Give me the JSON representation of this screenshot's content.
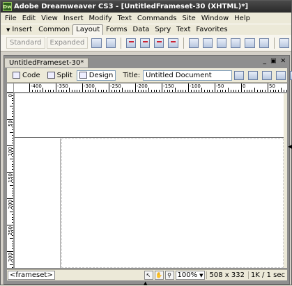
{
  "app": {
    "icon_text": "Dw",
    "title": "Adobe Dreamweaver CS3 - [UntitledFrameset-30 (XHTML)*]"
  },
  "menu": [
    "File",
    "Edit",
    "View",
    "Insert",
    "Modify",
    "Text",
    "Commands",
    "Site",
    "Window",
    "Help"
  ],
  "insert_bar": {
    "label": "Insert",
    "tabs": [
      {
        "label": "Common",
        "active": false
      },
      {
        "label": "Layout",
        "active": true
      },
      {
        "label": "Forms",
        "active": false
      },
      {
        "label": "Data",
        "active": false
      },
      {
        "label": "Spry",
        "active": false
      },
      {
        "label": "Text",
        "active": false
      },
      {
        "label": "Favorites",
        "active": false
      }
    ]
  },
  "layout_toolbar": {
    "standard_label": "Standard",
    "expanded_label": "Expanded"
  },
  "document": {
    "tab_label": "UntitledFrameset-30*",
    "view_buttons": {
      "code": "Code",
      "split": "Split",
      "design": "Design"
    },
    "title_label": "Title:",
    "title_value": "Untitled Document"
  },
  "ruler": {
    "h_labels": [
      "-400",
      "-350",
      "-300",
      "-250",
      "-200",
      "-150",
      "-100",
      "-50",
      "0",
      "50"
    ],
    "v_labels": [
      "0",
      "50",
      "100",
      "150",
      "200",
      "250",
      "300"
    ]
  },
  "status": {
    "tag_selector": "<frameset>",
    "zoom": "100%",
    "size": "508 x 332",
    "download": "1K / 1 sec"
  }
}
